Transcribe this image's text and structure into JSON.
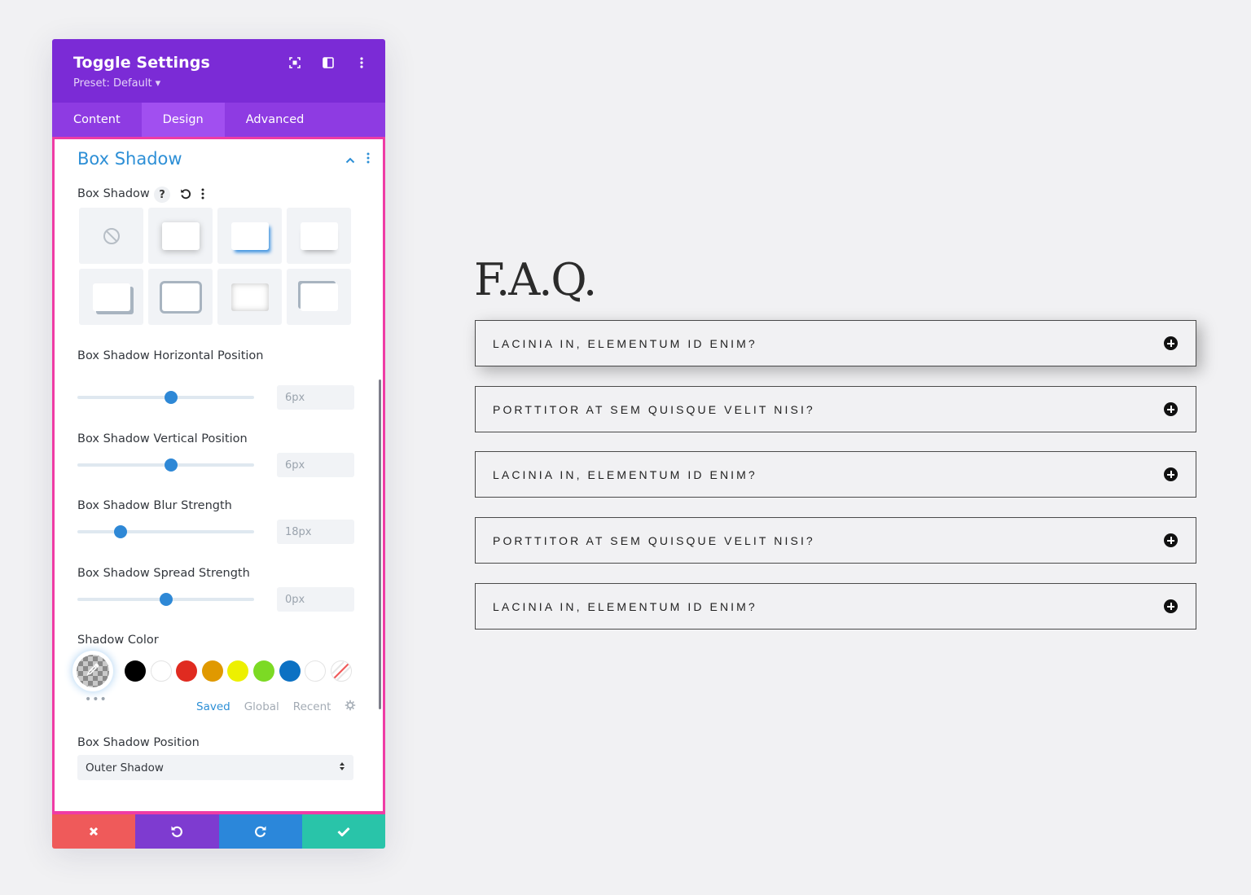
{
  "panel": {
    "title": "Toggle Settings",
    "preset": "Preset: Default ▾",
    "header_icons": [
      "focus-icon",
      "sidebar-layout-icon",
      "more-vertical-icon"
    ],
    "tabs": [
      {
        "label": "Content",
        "active": false
      },
      {
        "label": "Design",
        "active": true
      },
      {
        "label": "Advanced",
        "active": false
      }
    ],
    "section": {
      "title": "Box Shadow",
      "field_label": "Box Shadow",
      "help_label": "?",
      "presets": [
        "none",
        "all-around",
        "bottom-right-blue",
        "bottom-soft",
        "offset-bottom-left",
        "border-all",
        "inset",
        "offset-top-left"
      ],
      "sliders": [
        {
          "label": "Box Shadow Horizontal Position",
          "value": "6px",
          "position": 0.53
        },
        {
          "label": "Box Shadow Vertical Position",
          "value": "6px",
          "position": 0.53
        },
        {
          "label": "Box Shadow Blur Strength",
          "value": "18px",
          "position": 0.245
        },
        {
          "label": "Box Shadow Spread Strength",
          "value": "0px",
          "position": 0.5
        }
      ],
      "shadow_color_label": "Shadow Color",
      "swatches": [
        "#000000",
        "#ffffff",
        "#e02b20",
        "#e09900",
        "#edf000",
        "#7cda24",
        "#0c71c3",
        "#ffffff"
      ],
      "picker_dots": "•••",
      "palette_tabs": [
        {
          "label": "Saved",
          "active": true
        },
        {
          "label": "Global",
          "active": false
        },
        {
          "label": "Recent",
          "active": false
        }
      ],
      "position_label": "Box Shadow Position",
      "position_value": "Outer Shadow"
    },
    "footer_buttons": [
      {
        "name": "cancel",
        "color": "#ef5a5a"
      },
      {
        "name": "undo",
        "color": "#7e3bd0"
      },
      {
        "name": "redo",
        "color": "#2b87da"
      },
      {
        "name": "save",
        "color": "#29c4a9"
      }
    ]
  },
  "faq": {
    "title": "F.A.Q.",
    "items": [
      "LACINIA IN, ELEMENTUM ID ENIM?",
      "PORTTITOR AT SEM QUISQUE VELIT NISI?",
      "LACINIA IN, ELEMENTUM ID ENIM?",
      "PORTTITOR AT SEM QUISQUE VELIT NISI?",
      "LACINIA IN, ELEMENTUM ID ENIM?"
    ]
  }
}
